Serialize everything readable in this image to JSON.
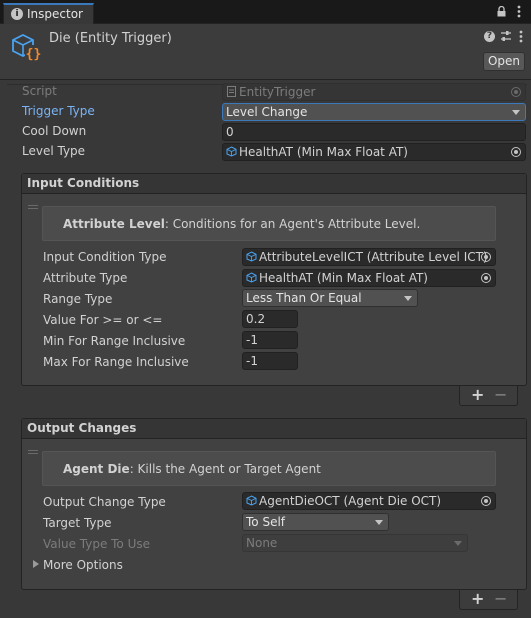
{
  "tab": {
    "label": "Inspector",
    "icon": "info-icon"
  },
  "header": {
    "component_icon": "cube-script-icon",
    "title": "Die (Entity Trigger)",
    "open_label": "Open",
    "help_icon": "help-icon",
    "preset_icon": "preset-sliders-icon",
    "menu_icon": "kebab-menu-icon"
  },
  "fields": {
    "script": {
      "label": "Script",
      "value": "EntityTrigger"
    },
    "trigger_type": {
      "label": "Trigger Type",
      "value": "Level Change"
    },
    "cool_down": {
      "label": "Cool Down",
      "value": "0"
    },
    "level_type": {
      "label": "Level Type",
      "value": "HealthAT (Min Max Float AT)"
    }
  },
  "input_conditions": {
    "title": "Input Conditions",
    "help_bold": "Attribute Level",
    "help_text": ": Conditions for an Agent's Attribute Level.",
    "rows": {
      "condition_type": {
        "label": "Input Condition Type",
        "value": "AttributeLevelICT (Attribute Level ICT)"
      },
      "attribute_type": {
        "label": "Attribute Type",
        "value": "HealthAT (Min Max Float AT)"
      },
      "range_type": {
        "label": "Range Type",
        "value": "Less Than Or Equal"
      },
      "value_for": {
        "label": "Value For >= or <=",
        "value": "0.2"
      },
      "min_range": {
        "label": "Min For Range Inclusive",
        "value": "-1"
      },
      "max_range": {
        "label": "Max For Range Inclusive",
        "value": "-1"
      }
    },
    "add": "+",
    "remove": "−"
  },
  "output_changes": {
    "title": "Output Changes",
    "help_bold": "Agent Die",
    "help_text": ": Kills the Agent or Target Agent",
    "rows": {
      "change_type": {
        "label": "Output Change Type",
        "value": "AgentDieOCT (Agent Die OCT)"
      },
      "target_type": {
        "label": "Target Type",
        "value": "To Self"
      },
      "value_type": {
        "label": "Value Type To Use",
        "value": "None"
      }
    },
    "more_options": "More Options",
    "add": "+",
    "remove": "−"
  },
  "colors": {
    "background": "#383838",
    "accent_blue": "#3a79bb",
    "label_blue": "#7ab4f5",
    "icon_blue": "#4aa3f0",
    "icon_orange": "#f08a30"
  }
}
